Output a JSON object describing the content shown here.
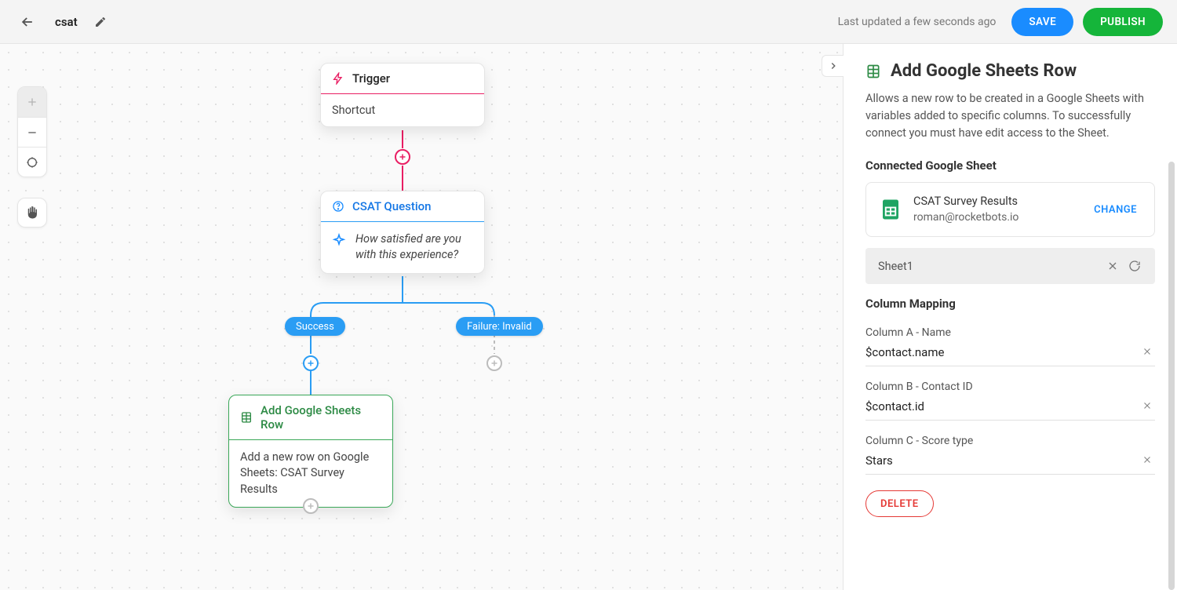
{
  "header": {
    "title": "csat",
    "updated": "Last updated a few seconds ago",
    "save": "SAVE",
    "publish": "PUBLISH"
  },
  "nodes": {
    "trigger": {
      "title": "Trigger",
      "body": "Shortcut"
    },
    "csat": {
      "title": "CSAT Question",
      "body": "How satisfied are you with this experience?"
    },
    "sheets": {
      "title": "Add Google Sheets Row",
      "body": "Add a new row on Google Sheets: CSAT Survey Results"
    }
  },
  "branches": {
    "success": "Success",
    "failure": "Failure: Invalid"
  },
  "panel": {
    "title": "Add Google Sheets Row",
    "description": "Allows a new row to be created in a Google Sheets with variables added to specific columns. To successfully connect you must have edit access to the Sheet.",
    "connected_label": "Connected Google Sheet",
    "connected": {
      "name": "CSAT Survey Results",
      "email": "roman@rocketbots.io",
      "change": "CHANGE"
    },
    "sheet_selected": "Sheet1",
    "mapping_label": "Column Mapping",
    "columns": [
      {
        "label": "Column A - Name",
        "value": "$contact.name"
      },
      {
        "label": "Column B - Contact ID",
        "value": "$contact.id"
      },
      {
        "label": "Column C - Score type",
        "value": "Stars"
      }
    ],
    "delete": "DELETE"
  }
}
